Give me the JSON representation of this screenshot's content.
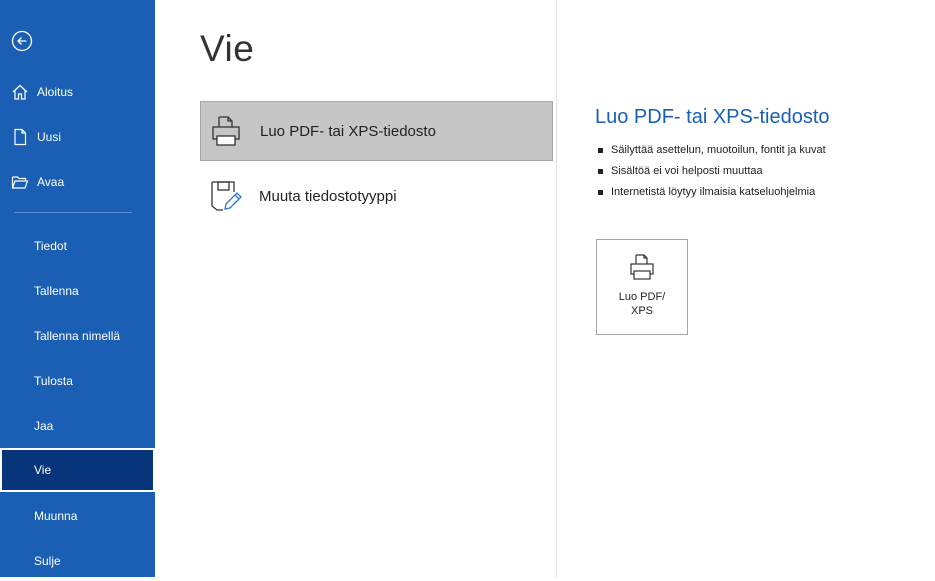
{
  "sidebar": {
    "items": [
      {
        "label": "Aloitus",
        "icon": "home-icon"
      },
      {
        "label": "Uusi",
        "icon": "new-document-icon"
      },
      {
        "label": "Avaa",
        "icon": "open-folder-icon"
      },
      {
        "label": "Tiedot"
      },
      {
        "label": "Tallenna"
      },
      {
        "label": "Tallenna nimellä"
      },
      {
        "label": "Tulosta"
      },
      {
        "label": "Jaa"
      },
      {
        "label": "Vie",
        "selected": true
      },
      {
        "label": "Muunna"
      },
      {
        "label": "Sulje"
      }
    ]
  },
  "main": {
    "title": "Vie",
    "options": [
      {
        "label": "Luo PDF- tai XPS-tiedosto",
        "icon": "printer-document-icon",
        "selected": true
      },
      {
        "label": "Muuta tiedostotyyppi",
        "icon": "change-file-type-icon"
      }
    ]
  },
  "details": {
    "title": "Luo PDF- tai XPS-tiedosto",
    "bullets": [
      "Säilyttää asettelun, muotoilun, fontit ja kuvat",
      "Sisältöä ei voi helposti muuttaa",
      "Internetistä löytyy ilmaisia katseluohjelmia"
    ],
    "button": {
      "line1": "Luo PDF/",
      "line2": "XPS"
    }
  },
  "colors": {
    "sidebar": "#1a5fb4",
    "sidebar_selected": "#06357a",
    "accent": "#1a5fb4",
    "option_selected": "#c6c6c6"
  }
}
